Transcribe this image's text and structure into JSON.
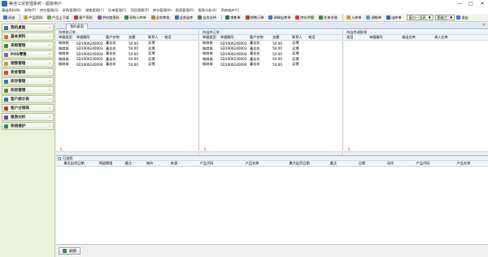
{
  "window": {
    "title": "美佳工贸管理系统 - 超级用户",
    "controls": [
      "—",
      "□",
      "✕"
    ]
  },
  "menu": [
    "基础资料(B)",
    "采购(P)",
    "库存管理(S)",
    "采购管理(O)",
    "销售管理(C)",
    "往来管理(F)",
    "项目管理(P)",
    "库存管理(K)",
    "报表管理(R)",
    "报表分析(A)",
    "系统维护(Y)"
  ],
  "toolbar": {
    "buttons": [
      {
        "label": "退出",
        "color": "#3d7ac8"
      },
      {
        "label": "产品资料",
        "color": "#d8a028"
      },
      {
        "label": "产品上下架",
        "color": "#6aa84f"
      },
      {
        "label": "客户资料",
        "color": "#cc3333"
      },
      {
        "label": "供应商资料",
        "color": "#8e5bbf"
      },
      {
        "label": "采购入库单",
        "color": "#2d8a5b"
      },
      {
        "label": "业务审批",
        "color": "#d27c1a"
      },
      {
        "label": "业务出库",
        "color": "#3c6fb5"
      },
      {
        "label": "业务支持",
        "color": "#6b6b6b"
      },
      {
        "label": "销售单",
        "color": "#2a7a3f"
      },
      {
        "label": "销售订单",
        "color": "#b0452d"
      },
      {
        "label": "调拨出库单",
        "color": "#4f77b8"
      },
      {
        "label": "库存余额",
        "color": "#cf3a3a"
      },
      {
        "label": "往来对账",
        "color": "#3b8a48"
      },
      {
        "label": "入库单",
        "color": "#d4a020"
      },
      {
        "label": "调拨单",
        "color": "#5a9ad0"
      },
      {
        "label": "出库单",
        "color": "#3366aa"
      }
    ],
    "dropdown_value": "窗口一览表",
    "dropdown_label": "勤能力",
    "exit_label": "退出"
  },
  "sidebar": {
    "items": [
      {
        "label": "我的桌面",
        "color": "#3b6fb6"
      },
      {
        "label": "基本资料",
        "color": "#d66a2a"
      },
      {
        "label": "采购管理",
        "color": "#2f8a4a"
      },
      {
        "label": "POS零售",
        "color": "#8a5ab8"
      },
      {
        "label": "销售管理",
        "color": "#c9a12a"
      },
      {
        "label": "资金管理",
        "color": "#d24a3a"
      },
      {
        "label": "库存管理",
        "color": "#2a7fb0"
      },
      {
        "label": "库房管理",
        "color": "#5a8a2a"
      },
      {
        "label": "客户统计表",
        "color": "#2f6fb0"
      },
      {
        "label": "客户分销商",
        "color": "#c0392b"
      },
      {
        "label": "报表分析",
        "color": "#6a4aa8"
      },
      {
        "label": "系统维护",
        "color": "#2e8b57"
      }
    ]
  },
  "tabs": [
    {
      "label": "我的桌面"
    }
  ],
  "panes": [
    {
      "title": "待审核订单",
      "headers": [
        "单据类型",
        "单据编号",
        "客户名称",
        "金额",
        "联系人",
        "电话"
      ],
      "rows": [
        [
          "微商城",
          "SD1906240002",
          "蕃佳花",
          "50.00",
          "吴博",
          ""
        ],
        [
          "微商城",
          "SD1906240003",
          "蕃佳花",
          "50.00",
          "吴博",
          ""
        ],
        [
          "微商城",
          "SD1906240004",
          "蕃佳花",
          "50.00",
          "吴博",
          ""
        ],
        [
          "微商城",
          "SD1906240005",
          "蕃佳花",
          "50.00",
          "吴博",
          ""
        ],
        [
          "微商城",
          "SD1906240006",
          "蕃佳花",
          "50.00",
          "吴博",
          ""
        ]
      ],
      "footer": "0"
    },
    {
      "title": "待出库订单",
      "headers": [
        "单据类型",
        "单据编号",
        "客户名称",
        "金额",
        "联系人",
        "电话"
      ],
      "rows": [
        [
          "微商城",
          "SD1906240002",
          "蕃佳花",
          "50.00",
          "吴博",
          ""
        ],
        [
          "微商城",
          "SD1906240003",
          "蕃佳花",
          "50.00",
          "吴博",
          ""
        ],
        [
          "微商城",
          "SD1906240004",
          "蕃佳花",
          "50.00",
          "吴博",
          ""
        ],
        [
          "微商城",
          "SD1906240005",
          "蕃佳花",
          "50.00",
          "吴博",
          ""
        ],
        [
          "微商城",
          "SD1906240006",
          "蕃佳花",
          "50.00",
          "吴博",
          ""
        ]
      ],
      "footer": "0"
    },
    {
      "title": "待出库调拨单",
      "headers": [
        "类型",
        "单据编号",
        "调出仓库",
        "调入仓库"
      ],
      "rows": [],
      "footer": "0"
    }
  ],
  "lower": {
    "title": "已选货",
    "headers": [
      "最近出货日期",
      "预留期限",
      "备注",
      "城市",
      "来源",
      "产品代码",
      "产品名称",
      "最大出货日期",
      "备注",
      "日期",
      "动作",
      "产品代码",
      "产品名称"
    ],
    "footer": "0"
  },
  "statusbar": {
    "refresh_label": "刷新"
  }
}
